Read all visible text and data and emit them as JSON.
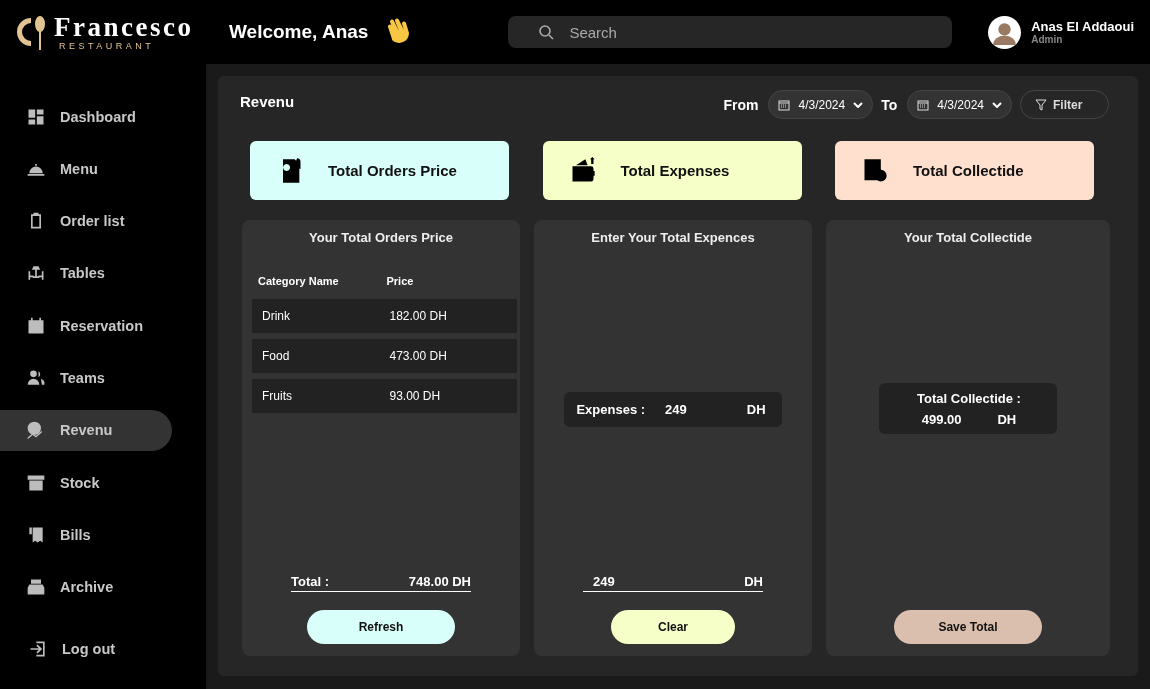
{
  "brand": {
    "name": "Francesco",
    "tagline": "RESTAURANT"
  },
  "header": {
    "greeting": "Welcome, Anas",
    "search": {
      "placeholder": "Search"
    },
    "user": {
      "name": "Anas El Addaoui",
      "role": "Admin"
    }
  },
  "sidebar": {
    "items": [
      {
        "label": "Dashboard",
        "selected": false
      },
      {
        "label": "Menu",
        "selected": false
      },
      {
        "label": "Order list",
        "selected": false
      },
      {
        "label": "Tables",
        "selected": false
      },
      {
        "label": "Reservation",
        "selected": false
      },
      {
        "label": "Teams",
        "selected": false
      },
      {
        "label": "Revenu",
        "selected": true
      },
      {
        "label": "Stock",
        "selected": false
      },
      {
        "label": "Bills",
        "selected": false
      },
      {
        "label": "Archive",
        "selected": false
      }
    ],
    "logout": "Log out"
  },
  "revenue": {
    "title": "Revenu",
    "from_label": "From",
    "from_date": "4/3/2024",
    "to_label": "To",
    "to_date": "4/3/2024",
    "filter": "Filter",
    "cards": [
      {
        "label": "Total Orders Price",
        "color": "#d9fffb"
      },
      {
        "label": "Total Expenses",
        "color": "#f7ffc9"
      },
      {
        "label": "Total Collectide",
        "color": "#ffe0cf"
      }
    ],
    "panels": [
      {
        "kind": "orders",
        "title": "Your Total Orders Price",
        "columns": [
          "Category Name",
          "Price"
        ],
        "rows": [
          [
            "Drink",
            "182.00 DH"
          ],
          [
            "Food",
            "473.00 DH"
          ],
          [
            "Fruits",
            "93.00 DH"
          ]
        ],
        "total_label": "Total :",
        "total_value": "748.00 DH",
        "button": "Refresh",
        "color": "#d9fffb"
      },
      {
        "kind": "expenses",
        "title": "Enter Your Total Expences",
        "summary_label": "Expenses :",
        "summary_value": "249",
        "summary_unit": "DH",
        "input_value": "249",
        "input_unit": "DH",
        "button": "Clear",
        "color": "#f7ffc9"
      },
      {
        "kind": "collected",
        "title": "Your Total Collectide",
        "summary_label": "Total Collectide :",
        "summary_value": "499.00",
        "summary_unit": "DH",
        "button": "Save Total",
        "color": "#dbbfae"
      }
    ]
  }
}
